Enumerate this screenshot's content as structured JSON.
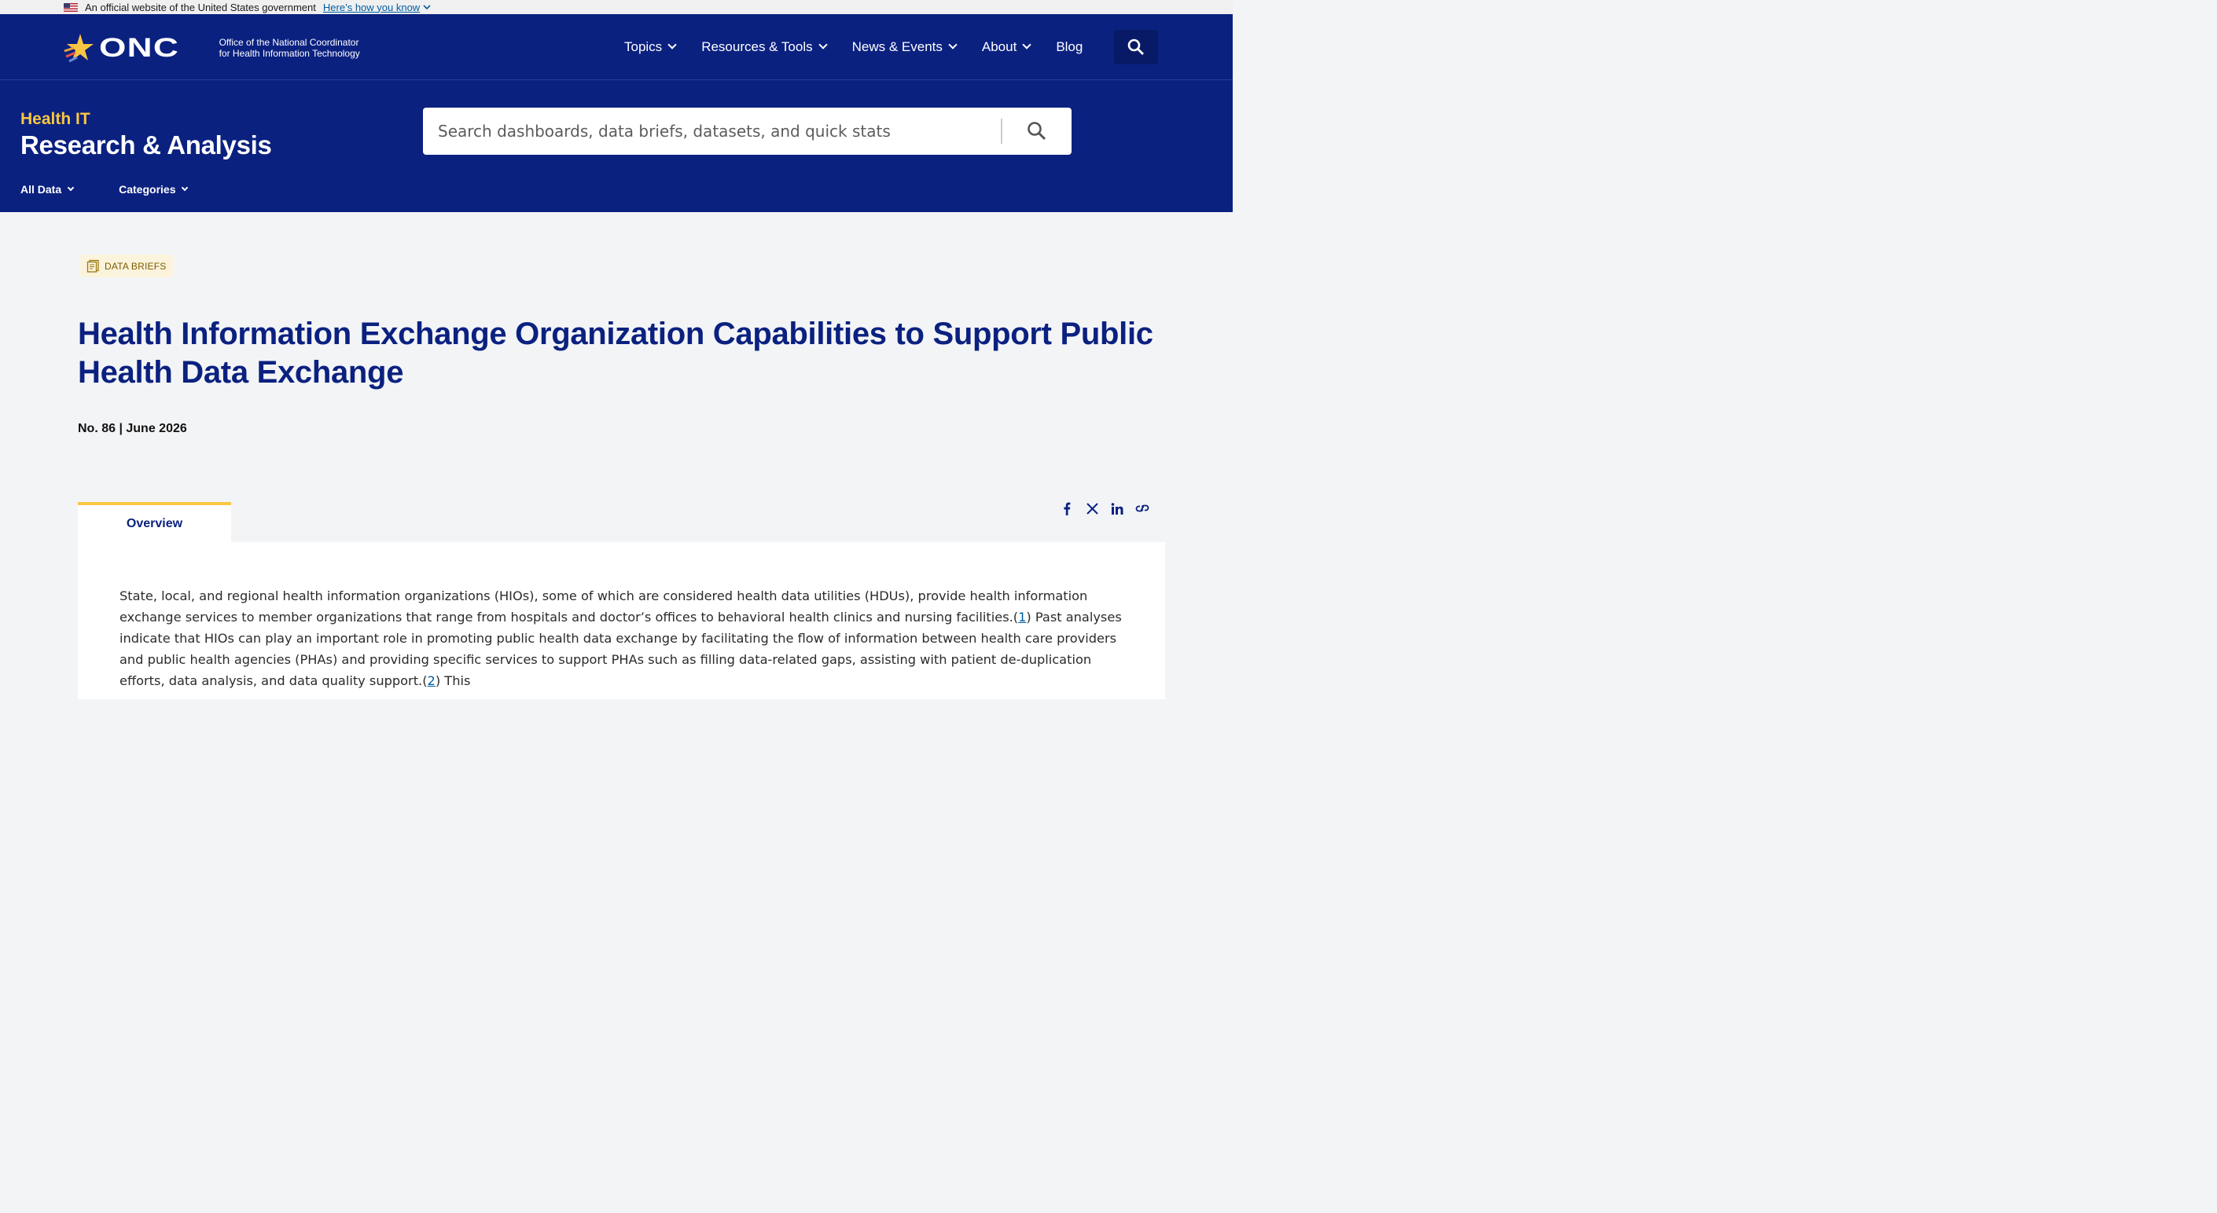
{
  "gov_banner": {
    "text": "An official website of the United States government",
    "link": "Here’s how you know"
  },
  "brand": {
    "logo_text": "ONC",
    "office_line1": "Office of the National Coordinator",
    "office_line2": "for Health Information Technology"
  },
  "nav": {
    "items": [
      {
        "label": "Topics"
      },
      {
        "label": "Resources & Tools"
      },
      {
        "label": "News & Events"
      },
      {
        "label": "About"
      },
      {
        "label": "Blog"
      }
    ]
  },
  "section": {
    "kicker": "Health IT",
    "title": "Research & Analysis"
  },
  "search": {
    "placeholder": "Search dashboards, data briefs, datasets, and quick stats"
  },
  "sub_menu": {
    "items": [
      {
        "label": "All Data"
      },
      {
        "label": "Categories"
      }
    ]
  },
  "article": {
    "badge": "DATA BRIEFS",
    "title": "Health Information Exchange Organization Capabilities to Support Public Health Data Exchange",
    "issue": "No. 86 | June 2026",
    "tab": "Overview",
    "para_a": "State, local, and regional health information organizations (HIOs), some of which are considered health data utilities (HDUs), provide health information exchange services to member organizations that range from hospitals and doctor’s offices to behavioral health clinics and nursing facilities.(",
    "ref1": "1",
    "para_b": ") Past analyses indicate that HIOs can play an important role in promoting public health data exchange by facilitating the flow of information between health care providers and public health agencies (PHAs) and providing specific services to support PHAs such as filling data-related gaps, assisting with patient de-duplication efforts, data analysis, and data quality support.(",
    "ref2": "2",
    "para_c": ") This"
  },
  "colors": {
    "navy": "#0b2180",
    "gold": "#f9c642",
    "link": "#005ea2"
  },
  "icons": [
    "flag-icon",
    "chevron-down-icon",
    "star-logo-icon",
    "search-icon",
    "document-icon",
    "facebook-icon",
    "x-icon",
    "linkedin-icon",
    "link-icon"
  ]
}
